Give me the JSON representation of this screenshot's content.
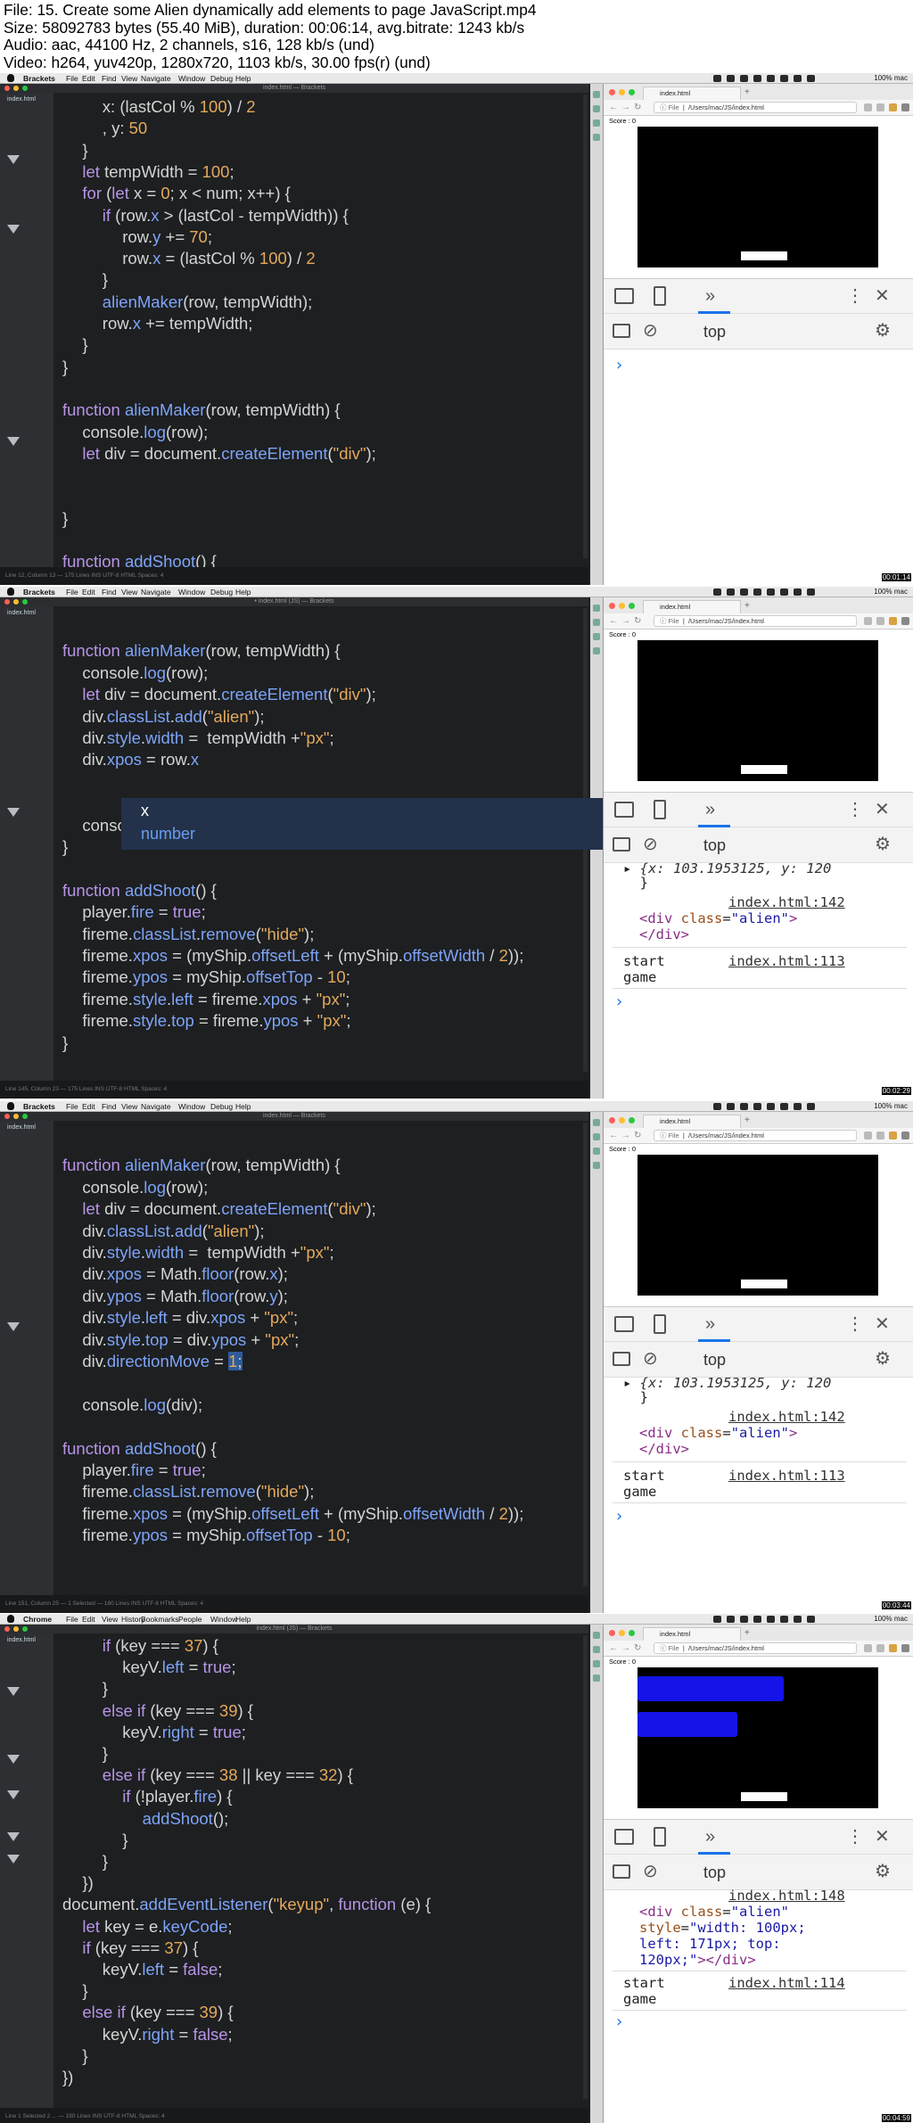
{
  "header": {
    "line1": "File: 15. Create some Alien dynamically add elements to page JavaScript.mp4",
    "line2": "Size: 58092783 bytes (55.40 MiB), duration: 00:06:14, avg.bitrate: 1243 kb/s",
    "line3": "Audio: aac, 44100 Hz, 2 channels, s16, 128 kb/s (und)",
    "line4": "Video: h264, yuv420p, 1280x720, 1103 kb/s, 30.00 fps(r) (und)"
  },
  "menubar_items_brackets": [
    "Brackets",
    "File",
    "Edit",
    "Find",
    "View",
    "Navigate",
    "Window",
    "Debug",
    "Help"
  ],
  "menubar_items_chrome": [
    "Chrome",
    "File",
    "Edit",
    "View",
    "History",
    "Bookmarks",
    "People",
    "Window",
    "Help"
  ],
  "menubar_status": "100%  mac",
  "editor": {
    "title_frame1": "index.html — Brackets",
    "title_frame2": "• index.html (JS) — Brackets",
    "title_frame3": "index.html — Brackets",
    "title_frame4": "index.html (JS) — Brackets",
    "file_name": "index.html",
    "status_frame1": "Line 12, Column 13 — 175 Lines",
    "status_frame2": "Line 145, Column 23 — 175 Lines",
    "status_frame3": "Line 151, Column 25 — 1 Selected — 180 Lines",
    "status_frame4": "Line 1 Selected 2 ... — 190 Lines",
    "status_right": "INS   UTF-8   HTML   Spaces: 4"
  },
  "browser": {
    "tab_title": "index.html",
    "url_label": "File",
    "url": "/Users/mac/JS/index.html",
    "score": "Score : 0",
    "devtools_context": "top"
  },
  "frame1": {
    "code": [
      "                x: (lastCol % 100) / 2",
      "                , y: 50",
      "            }",
      "            let tempWidth = 100;",
      "            for (let x = 0; x < num; x++) {",
      "                if (row.x > (lastCol - tempWidth)) {",
      "                    row.y += 70;",
      "                    row.x = (lastCol % 100) / 2",
      "                }",
      "                alienMaker(row, tempWidth);",
      "                row.x += tempWidth;",
      "            }",
      "        }",
      "",
      "        function alienMaker(row, tempWidth) {",
      "            console.log(row);",
      "            let div = document.createElement(\"div\");",
      "",
      "",
      "        }",
      "",
      "        function addShoot() {"
    ],
    "timestamp": "00:01:14"
  },
  "frame2": {
    "code": [
      "",
      "        function alienMaker(row, tempWidth) {",
      "            console.log(row);",
      "            let div = document.createElement(\"div\");",
      "            div.classList.add(\"alien\");",
      "            div.style.width =  tempWidth +\"px\";",
      "            div.xpos = row.x",
      "",
      "",
      "            console.log(div);",
      "        }",
      "",
      "        function addShoot() {",
      "            player.fire = true;",
      "            fireme.classList.remove(\"hide\");",
      "            fireme.xpos = (myShip.offsetLeft + (myShip.offsetWidth / 2));",
      "            fireme.ypos = myShip.offsetTop - 10;",
      "            fireme.style.left = fireme.xpos + \"px\";",
      "            fireme.style.top = fireme.ypos + \"px\";",
      "        }"
    ],
    "autocomplete_item": "x",
    "autocomplete_type": "number",
    "console": {
      "obj_line1": "{x: 103.1953125, y: 120",
      "obj_line2": "}",
      "link1": "index.html:142",
      "div_line1": "<div class=\"alien\">",
      "div_line2": "</div>",
      "log_text1": "start",
      "log_text2": "game",
      "link2": "index.html:113"
    },
    "timestamp": "00:02:29"
  },
  "frame3": {
    "code": [
      "",
      "        function alienMaker(row, tempWidth) {",
      "            console.log(row);",
      "            let div = document.createElement(\"div\");",
      "            div.classList.add(\"alien\");",
      "            div.style.width =  tempWidth +\"px\";",
      "            div.xpos = Math.floor(row.x);",
      "            div.ypos = Math.floor(row.y);",
      "            div.style.left = div.xpos + \"px\";",
      "            div.style.top = div.ypos + \"px\";",
      "            div.directionMove = 1;",
      "",
      "            console.log(div);",
      "",
      "        function addShoot() {",
      "            player.fire = true;",
      "            fireme.classList.remove(\"hide\");",
      "            fireme.xpos = (myShip.offsetLeft + (myShip.offsetWidth / 2));",
      "            fireme.ypos = myShip.offsetTop - 10;"
    ],
    "console": {
      "obj_line1": "{x: 103.1953125, y: 120",
      "obj_line2": "}",
      "link1": "index.html:142",
      "div_line1": "<div class=\"alien\">",
      "div_line2": "</div>",
      "log_text1": "start",
      "log_text2": "game",
      "link2": "index.html:113"
    },
    "timestamp": "00:03:44"
  },
  "frame4": {
    "code": [
      "                if (key === 37) {",
      "                    keyV.left = true;",
      "                }",
      "                else if (key === 39) {",
      "                    keyV.right = true;",
      "                }",
      "                else if (key === 38 || key === 32) {",
      "                    if (!player.fire) {",
      "                        addShoot();",
      "                    }",
      "                }",
      "            })",
      "        document.addEventListener(\"keyup\", function (e) {",
      "            let key = e.keyCode;",
      "            if (key === 37) {",
      "                keyV.left = false;",
      "            }",
      "            else if (key === 39) {",
      "                keyV.right = false;",
      "            }",
      "        })"
    ],
    "console": {
      "link1": "index.html:148",
      "div_line1": "<div class=\"alien\"",
      "div_line2": "style=\"width: 100px;",
      "div_line3": "left: 171px; top:",
      "div_line4": "120px;\"></div>",
      "log_text1": "start",
      "log_text2": "game",
      "link2": "index.html:114"
    },
    "timestamp": "00:04:59"
  }
}
